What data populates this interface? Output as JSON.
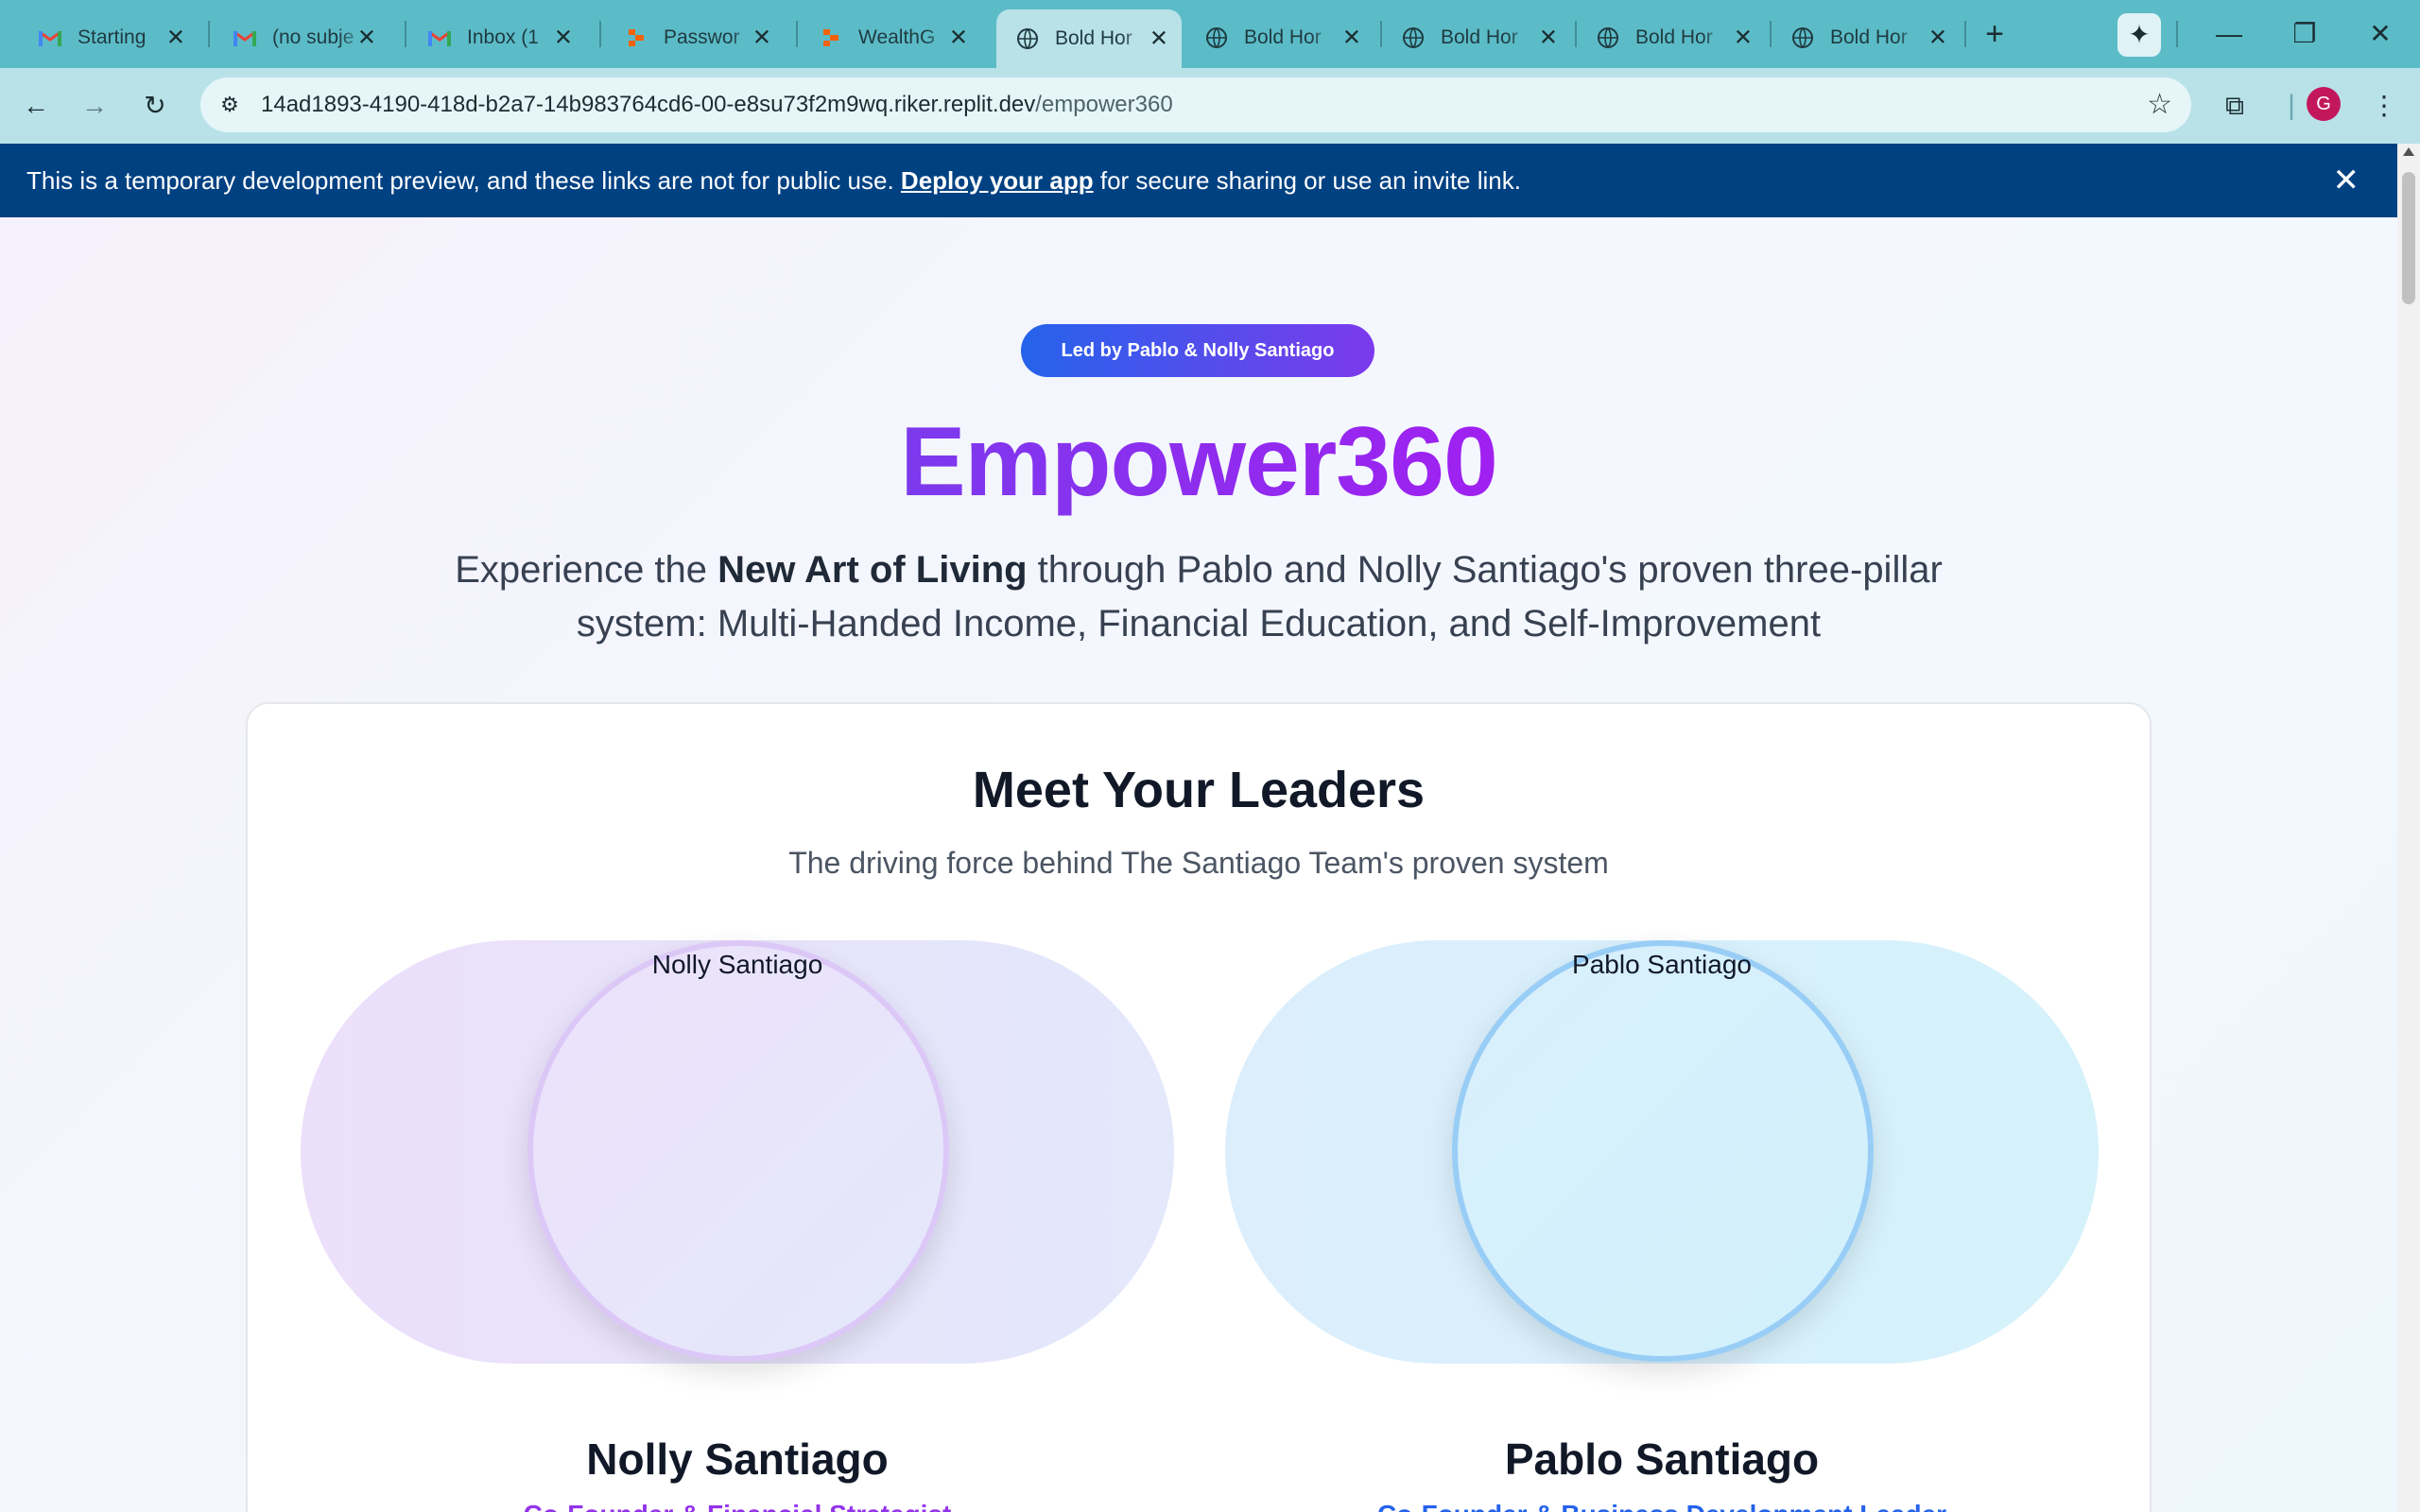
{
  "browser": {
    "tabs": [
      {
        "title": "Starting",
        "icon": "gmail-icon"
      },
      {
        "title": "(no subje",
        "icon": "gmail-icon"
      },
      {
        "title": "Inbox (1",
        "icon": "gmail-icon"
      },
      {
        "title": "Passwor",
        "icon": "replit-icon"
      },
      {
        "title": "WealthG",
        "icon": "replit-icon"
      },
      {
        "title": "Bold Hor",
        "icon": "globe-icon",
        "active": true
      },
      {
        "title": "Bold Hor",
        "icon": "globe-icon"
      },
      {
        "title": "Bold Hor",
        "icon": "globe-icon"
      },
      {
        "title": "Bold Hor",
        "icon": "globe-icon"
      },
      {
        "title": "Bold Hor",
        "icon": "globe-icon"
      }
    ],
    "url_host": "14ad1893-4190-418d-b2a7-14b983764cd6-00-e8su73f2m9wq.riker.replit.dev",
    "url_path": "/empower360",
    "profile_initial": "G"
  },
  "banner": {
    "text_before": "This is a temporary development preview, and these links are not for public use. ",
    "link": "Deploy your app",
    "text_after": " for secure sharing or use an invite link."
  },
  "hero": {
    "pill": "Led by Pablo & Nolly Santiago",
    "title": "Empower360",
    "sub_before": "Experience the ",
    "sub_bold": "New Art of Living",
    "sub_after": " through Pablo and Nolly Santiago's proven three-pillar system: Multi-Handed Income, Financial Education, and Self-Improvement"
  },
  "leaders_section": {
    "title": "Meet Your Leaders",
    "subtitle": "The driving force behind The Santiago Team's proven system",
    "leaders": [
      {
        "photo_alt": "Nolly Santiago",
        "name": "Nolly Santiago",
        "role": "Co-Founder & Financial Strategist"
      },
      {
        "photo_alt": "Pablo Santiago",
        "name": "Pablo Santiago",
        "role": "Co-Founder & Business Development Leader"
      }
    ]
  },
  "colors": {
    "tabstrip": "#5bbcc8",
    "toolbar": "#b9e2e8",
    "banner": "#004182",
    "accent_purple": "#7c3aed",
    "accent_blue": "#2563eb"
  }
}
